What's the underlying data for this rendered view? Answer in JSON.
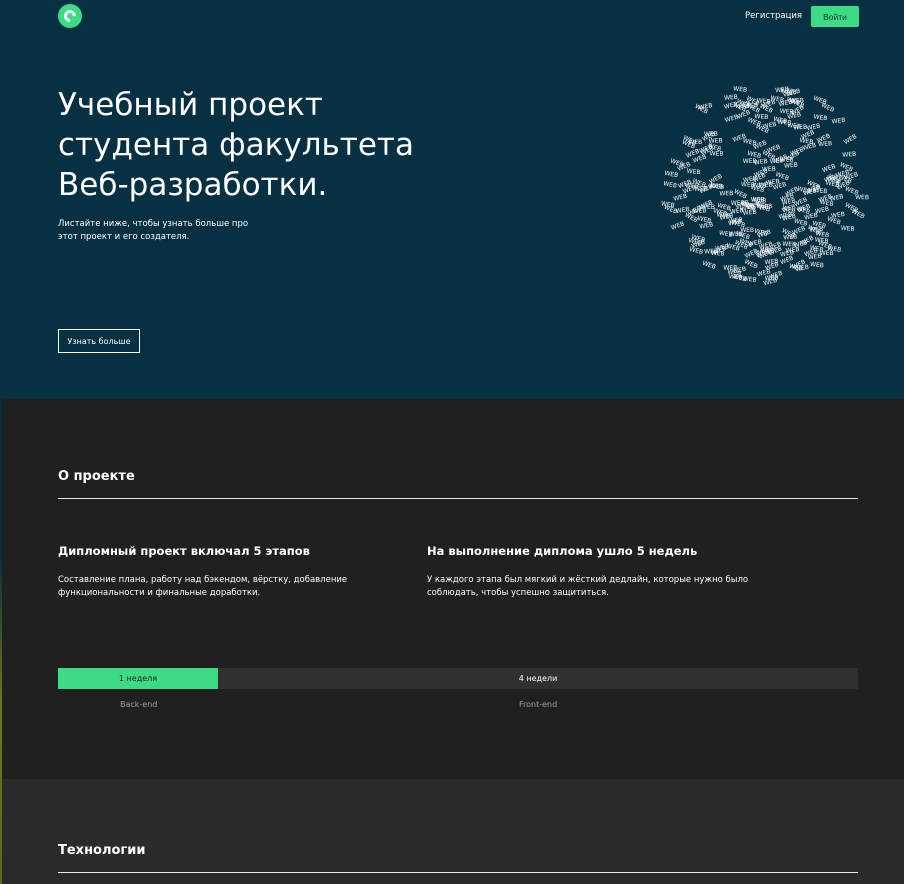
{
  "header": {
    "register_label": "Регистрация",
    "login_label": "Войти"
  },
  "hero": {
    "title": "Учебный проект студента факультета Веб-разработки.",
    "subtitle": "Листайте ниже, чтобы узнать больше про этот проект и его создателя.",
    "button_label": "Узнать больше",
    "globe_word": "WEB"
  },
  "about": {
    "title": "О проекте",
    "columns": [
      {
        "title": "Дипломный проект включал 5 этапов",
        "text": "Составление плана, работу над бэкендом, вёрстку, добавление функциональности и финальные доработки."
      },
      {
        "title": "На выполнение диплома ушло 5 недель",
        "text": "У каждого этапа был мягкий и жёсткий дедлайн, которые нужно было соблюдать, чтобы успешно защититься."
      }
    ],
    "timeline": {
      "backend": {
        "duration": "1 неделя",
        "label": "Back-end",
        "weeks": 1
      },
      "frontend": {
        "duration": "4 недели",
        "label": "Front-end",
        "weeks": 4
      }
    }
  },
  "tech": {
    "title": "Технологии"
  },
  "colors": {
    "hero_bg": "#073042",
    "accent": "#3ddc84",
    "about_bg": "#202020",
    "tech_bg": "#2b2b2b"
  }
}
